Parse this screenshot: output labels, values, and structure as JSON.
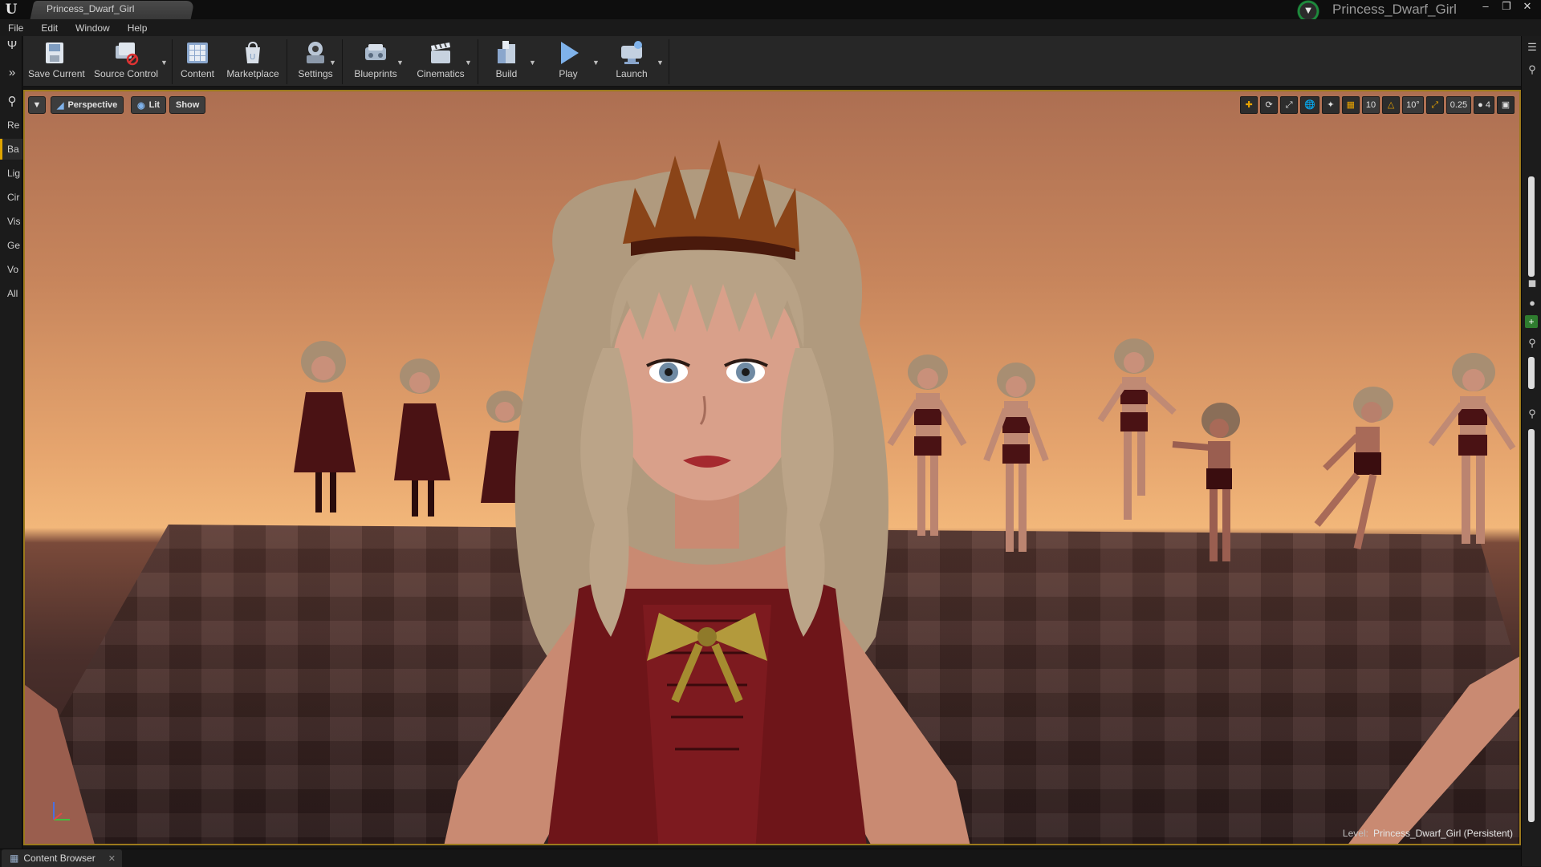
{
  "window": {
    "tab_title": "Princess_Dwarf_Girl",
    "project_name": "Princess_Dwarf_Girl",
    "controls": [
      "minimize-icon",
      "maximize-icon",
      "close-icon"
    ]
  },
  "menu": [
    "File",
    "Edit",
    "Window",
    "Help"
  ],
  "left_panel": {
    "tabs": [
      "Re",
      "Ba",
      "Lig",
      "Cir",
      "Vis",
      "Ge",
      "Vo",
      "All"
    ],
    "active_tab": "Ba"
  },
  "toolbar": {
    "items": [
      {
        "label": "Save Current",
        "icon": "save-icon"
      },
      {
        "label": "Source Control",
        "icon": "source-control-icon"
      },
      {
        "label": "Content",
        "icon": "content-icon"
      },
      {
        "label": "Marketplace",
        "icon": "marketplace-icon"
      },
      {
        "label": "Settings",
        "icon": "settings-icon"
      },
      {
        "label": "Blueprints",
        "icon": "blueprints-icon"
      },
      {
        "label": "Cinematics",
        "icon": "cinematics-icon"
      },
      {
        "label": "Build",
        "icon": "build-icon"
      },
      {
        "label": "Play",
        "icon": "play-icon"
      },
      {
        "label": "Launch",
        "icon": "launch-icon"
      }
    ]
  },
  "viewport": {
    "view_mode": "Perspective",
    "lighting": "Lit",
    "show_label": "Show",
    "grid_snap": "10",
    "rotation_snap": "10°",
    "scale_snap": "0.25",
    "camera_speed": "4",
    "level_label": "Level:",
    "level_name": "Princess_Dwarf_Girl (Persistent)"
  },
  "bottom": {
    "content_browser_tab": "Content Browser"
  },
  "colors": {
    "accent": "#e0a500",
    "viewport_border": "#9c7a1c",
    "project_ring": "#1d8a3c"
  }
}
